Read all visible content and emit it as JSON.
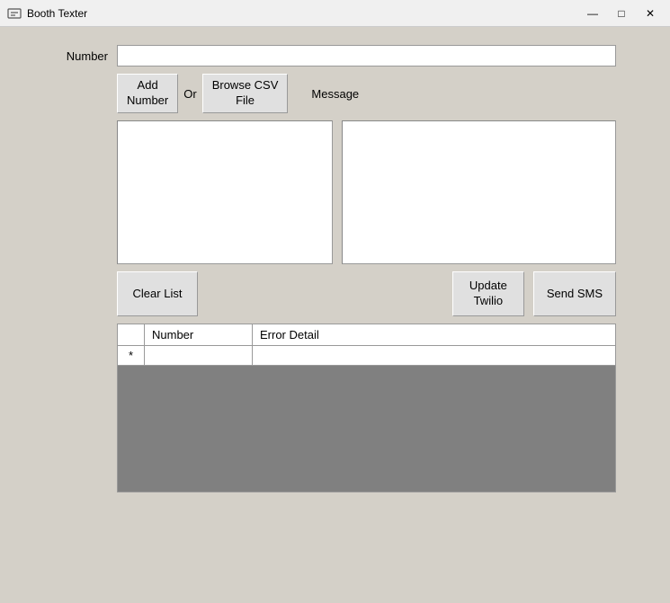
{
  "window": {
    "title": "Booth Texter",
    "icon": "💬"
  },
  "title_bar": {
    "minimize_label": "—",
    "maximize_label": "□",
    "close_label": "✕"
  },
  "form": {
    "number_label": "Number",
    "number_placeholder": "",
    "add_number_btn": "Add\nNumber",
    "or_label": "Or",
    "browse_csv_btn": "Browse CSV\nFile",
    "message_label": "Message",
    "clear_list_btn": "Clear List",
    "update_twilio_btn": "Update\nTwilio",
    "send_sms_btn": "Send SMS"
  },
  "table": {
    "col_row_num": "",
    "col_number": "Number",
    "col_error": "Error Detail",
    "asterisk_row": "*",
    "rows": []
  }
}
